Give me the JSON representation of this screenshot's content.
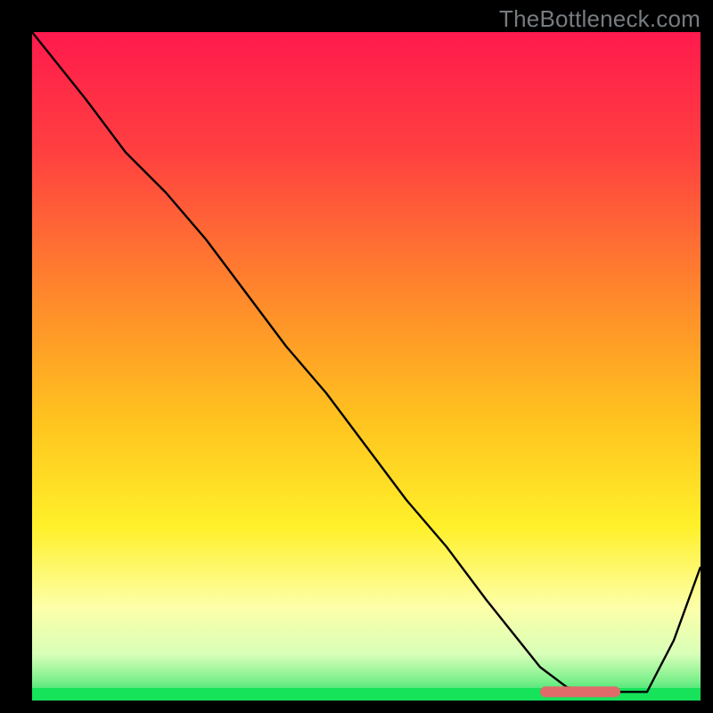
{
  "watermark": "TheBottleneck.com",
  "colors": {
    "frame_bg": "#000000",
    "curve": "#000000",
    "marker": "#e06a6a",
    "gradient_stops": [
      {
        "offset": 0,
        "color": "#ff1a4d"
      },
      {
        "offset": 18,
        "color": "#ff4040"
      },
      {
        "offset": 40,
        "color": "#ff8a2b"
      },
      {
        "offset": 58,
        "color": "#ffc31f"
      },
      {
        "offset": 74,
        "color": "#fff02a"
      },
      {
        "offset": 86,
        "color": "#fdffa8"
      },
      {
        "offset": 93,
        "color": "#d9ffb8"
      },
      {
        "offset": 97,
        "color": "#7df08c"
      },
      {
        "offset": 100,
        "color": "#1ddb62"
      }
    ],
    "green_strip": "#16e25a"
  },
  "chart_data": {
    "type": "line",
    "title": "",
    "xlabel": "",
    "ylabel": "",
    "xlim": [
      0,
      100
    ],
    "ylim": [
      0,
      100
    ],
    "grid": false,
    "legend": false,
    "series": [
      {
        "name": "bottleneck-curve",
        "x": [
          0,
          8,
          14,
          20,
          26,
          32,
          38,
          44,
          50,
          56,
          62,
          68,
          72,
          76,
          80,
          84,
          88,
          92,
          96,
          100
        ],
        "y": [
          100,
          90,
          82,
          76,
          69,
          61,
          53,
          46,
          38,
          30,
          23,
          15,
          10,
          5,
          2,
          1.3,
          1.3,
          1.3,
          9,
          20
        ]
      }
    ],
    "marker": {
      "name": "optimal-zone",
      "shape": "rounded-bar",
      "x_start": 76,
      "x_end": 88,
      "y": 1.3
    }
  }
}
